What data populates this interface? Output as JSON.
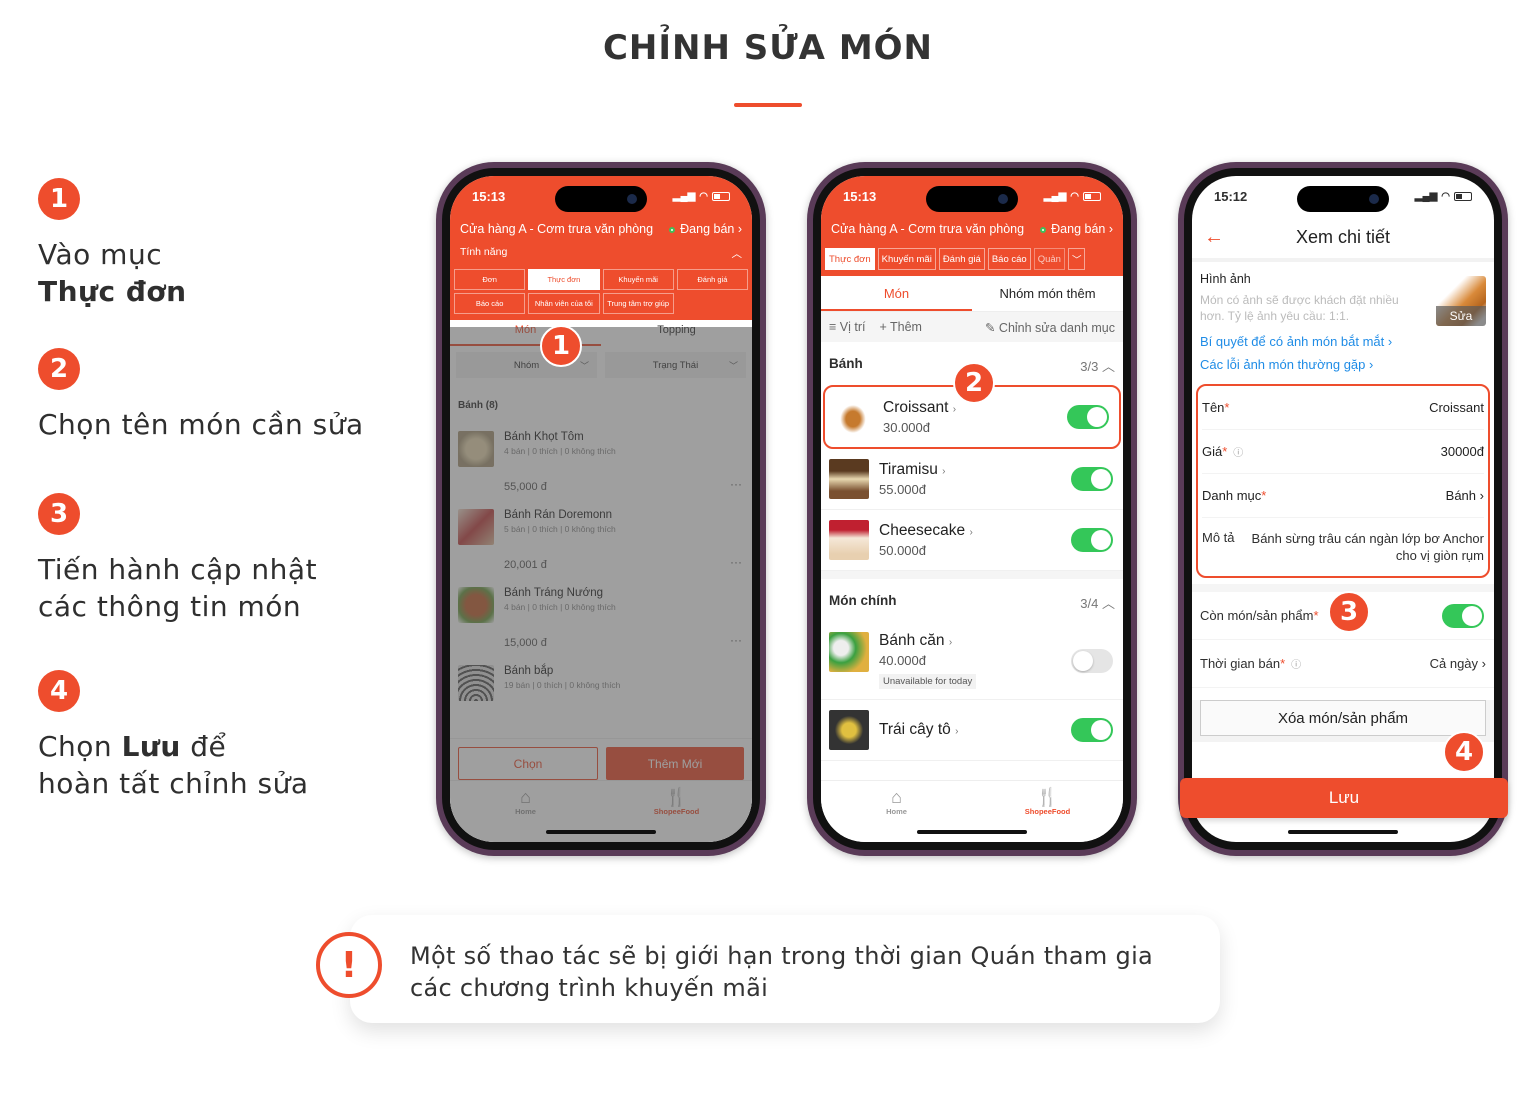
{
  "page": {
    "title": "CHỈNH SỬA MÓN",
    "accent_color": "#ee4d2d"
  },
  "steps": [
    {
      "num": "1",
      "line1": "Vào mục",
      "bold": "Thực đơn"
    },
    {
      "num": "2",
      "line1": "Chọn tên món cần sửa"
    },
    {
      "num": "3",
      "line1": "Tiến hành cập nhật",
      "line2": "các thông tin món"
    },
    {
      "num": "4",
      "pre": "Chọn ",
      "bold": "Lưu",
      "post": " để",
      "line2": "hoàn tất chỉnh sửa"
    }
  ],
  "phone1": {
    "time": "15:13",
    "store": "Cửa hàng A - Cơm trưa văn phòng",
    "status": "Đang bán",
    "features_label": "Tính năng",
    "features": [
      "Đơn",
      "Thực đơn",
      "Khuyến mãi",
      "Đánh giá",
      "Báo cáo",
      "Nhân viên của tôi",
      "Trung tâm trợ giúp"
    ],
    "active_feature": "Thực đơn",
    "tabs": [
      "Món",
      "Topping"
    ],
    "filters": [
      "Nhóm",
      "Trạng Thái"
    ],
    "group": "Bánh (8)",
    "items": [
      {
        "name": "Bánh Khọt Tôm",
        "meta": "4 bán | 0 thích | 0 không thích",
        "price": "55,000 đ"
      },
      {
        "name": "Bánh Rán Doremonn",
        "meta": "5 bán | 0 thích | 0 không thích",
        "price": "20,001 đ"
      },
      {
        "name": "Bánh Tráng Nướng",
        "meta": "4 bán | 0 thích | 0 không thích",
        "price": "15,000 đ"
      },
      {
        "name": "Bánh bắp",
        "meta": "19 bán | 0 thích | 0 không thích",
        "price": ""
      }
    ],
    "btn_select": "Chọn",
    "btn_add": "Thêm Mới",
    "nav": [
      "Home",
      "ShopeeFood"
    ],
    "badge": "1"
  },
  "phone2": {
    "time": "15:13",
    "store": "Cửa hàng A - Cơm trưa văn phòng",
    "status": "Đang bán",
    "tabs": [
      "Thực đơn",
      "Khuyến mãi",
      "Đánh giá",
      "Báo cáo",
      "Quản"
    ],
    "subtabs": [
      "Món",
      "Nhóm món thêm"
    ],
    "tools": {
      "position": "≡ Vị trí",
      "add": "+ Thêm",
      "edit": "Chỉnh sửa danh mục"
    },
    "categories": [
      {
        "name": "Bánh",
        "count": "3/3",
        "items": [
          {
            "name": "Croissant",
            "price": "30.000đ",
            "available": true
          },
          {
            "name": "Tiramisu",
            "price": "55.000đ",
            "available": true
          },
          {
            "name": "Cheesecake",
            "price": "50.000đ",
            "available": true
          }
        ]
      },
      {
        "name": "Món chính",
        "count": "3/4",
        "items": [
          {
            "name": "Bánh căn",
            "price": "40.000đ",
            "available": false,
            "note": "Unavailable for today"
          },
          {
            "name": "Trái cây tô",
            "price": "",
            "available": true
          }
        ]
      }
    ],
    "nav": [
      "Home",
      "ShopeeFood"
    ],
    "badge": "2"
  },
  "phone3": {
    "time": "15:12",
    "header": "Xem chi tiết",
    "image_label": "Hình ảnh",
    "image_desc": "Món có ảnh sẽ được khách đặt nhiều hơn. Tỷ lệ ảnh yêu cầu: 1:1.",
    "image_edit": "Sửa",
    "link1": "Bí quyết để có ảnh món bắt mắt",
    "link2": "Các lỗi ảnh món thường gặp",
    "name_label": "Tên",
    "name_value": "Croissant",
    "price_label": "Giá",
    "price_value": "30000đ",
    "category_label": "Danh mục",
    "category_value": "Bánh",
    "desc_label": "Mô tả",
    "desc_value": "Bánh sừng trâu cán ngàn lớp bơ Anchor cho vị giòn rụm",
    "stock_label": "Còn món/sản phẩm",
    "stock_on": true,
    "time_label": "Thời gian bán",
    "time_value": "Cả ngày",
    "delete_btn": "Xóa món/sản phẩm",
    "save_btn": "Lưu",
    "badge3": "3",
    "badge4": "4"
  },
  "note": {
    "icon": "!",
    "line1": "Một số thao tác sẽ bị giới hạn trong thời gian Quán tham gia",
    "line2": "các chương trình khuyến mãi"
  }
}
